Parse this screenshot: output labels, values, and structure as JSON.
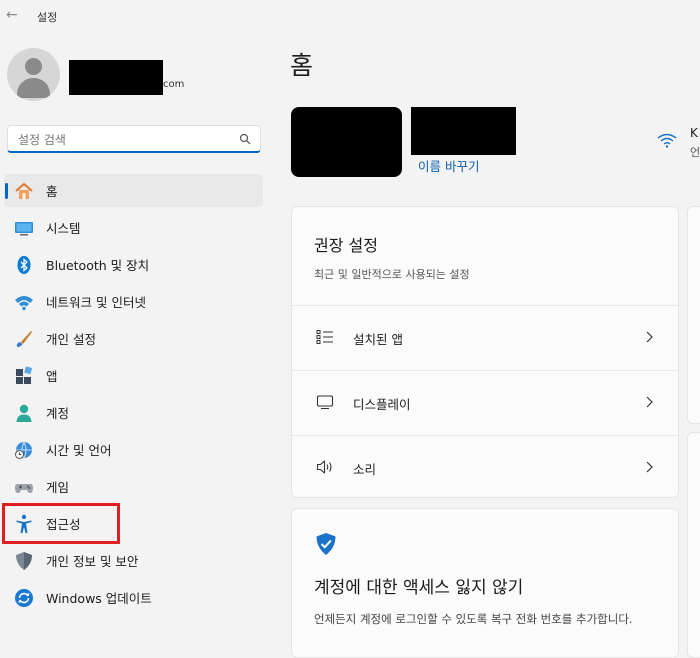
{
  "window": {
    "title": "설정"
  },
  "account": {
    "email_suffix": "com"
  },
  "search": {
    "placeholder": "설정 검색"
  },
  "sidebar": {
    "items": [
      {
        "label": "홈"
      },
      {
        "label": "시스템"
      },
      {
        "label": "Bluetooth 및 장치"
      },
      {
        "label": "네트워크 및 인터넷"
      },
      {
        "label": "개인 설정"
      },
      {
        "label": "앱"
      },
      {
        "label": "계정"
      },
      {
        "label": "시간 및 언어"
      },
      {
        "label": "게임"
      },
      {
        "label": "접근성"
      },
      {
        "label": "개인 정보 및 보안"
      },
      {
        "label": "Windows 업데이트"
      }
    ],
    "active_index": 0
  },
  "main": {
    "title": "홈",
    "rename_link": "이름 바꾸기",
    "network": {
      "name": "K",
      "status": "언"
    },
    "recommended": {
      "title": "권장 설정",
      "subtitle": "최근 및 일반적으로 사용되는 설정",
      "rows": [
        {
          "label": "설치된 앱",
          "icon": "list-icon"
        },
        {
          "label": "디스플레이",
          "icon": "monitor-icon"
        },
        {
          "label": "소리",
          "icon": "speaker-icon"
        }
      ]
    },
    "security": {
      "title": "계정에 대한 액세스 잃지 않기",
      "description": "언제든지 계정에 로그인할 수 있도록 복구 전화 번호를 추가합니다."
    }
  },
  "colors": {
    "accent": "#0067c0",
    "highlight": "#e02020",
    "background": "#f3f3f3",
    "card": "#fbfbfb"
  }
}
